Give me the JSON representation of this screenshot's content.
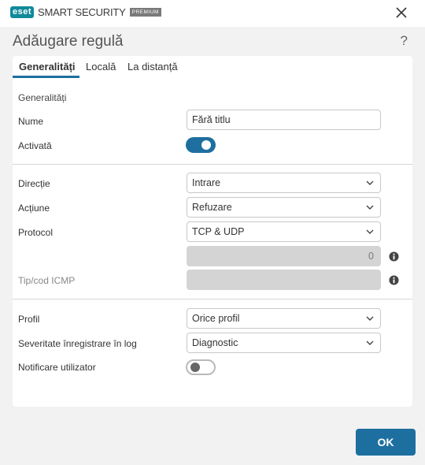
{
  "app": {
    "logo_text": "eset",
    "product_name": "SMART SECURITY",
    "edition_badge": "PREMIUM"
  },
  "dialog": {
    "title": "Adăugare regulă",
    "help_label": "?"
  },
  "tabs": [
    {
      "label": "Generalități",
      "active": true
    },
    {
      "label": "Locală",
      "active": false
    },
    {
      "label": "La distanță",
      "active": false
    }
  ],
  "form": {
    "section_general": "Generalități",
    "name": {
      "label": "Nume",
      "value": "Fără titlu"
    },
    "enabled": {
      "label": "Activată",
      "state": true
    },
    "direction": {
      "label": "Direcție",
      "value": "Intrare"
    },
    "action": {
      "label": "Acțiune",
      "value": "Refuzare"
    },
    "protocol": {
      "label": "Protocol",
      "value": "TCP & UDP"
    },
    "protocol_number": {
      "value": "0",
      "disabled": true,
      "info_icon": "info-icon"
    },
    "icmp": {
      "label": "Tip/cod ICMP",
      "value": "",
      "disabled": true,
      "info_icon": "info-icon"
    },
    "profile": {
      "label": "Profil",
      "value": "Orice profil"
    },
    "log_severity": {
      "label": "Severitate înregistrare în log",
      "value": "Diagnostic"
    },
    "notify_user": {
      "label": "Notificare utilizator",
      "state": false
    }
  },
  "footer": {
    "ok_label": "OK"
  },
  "colors": {
    "accent": "#1d6f9f",
    "brand": "#0f8a9b",
    "background": "#f2f2f2",
    "disabled_field": "#d4d4d4"
  }
}
